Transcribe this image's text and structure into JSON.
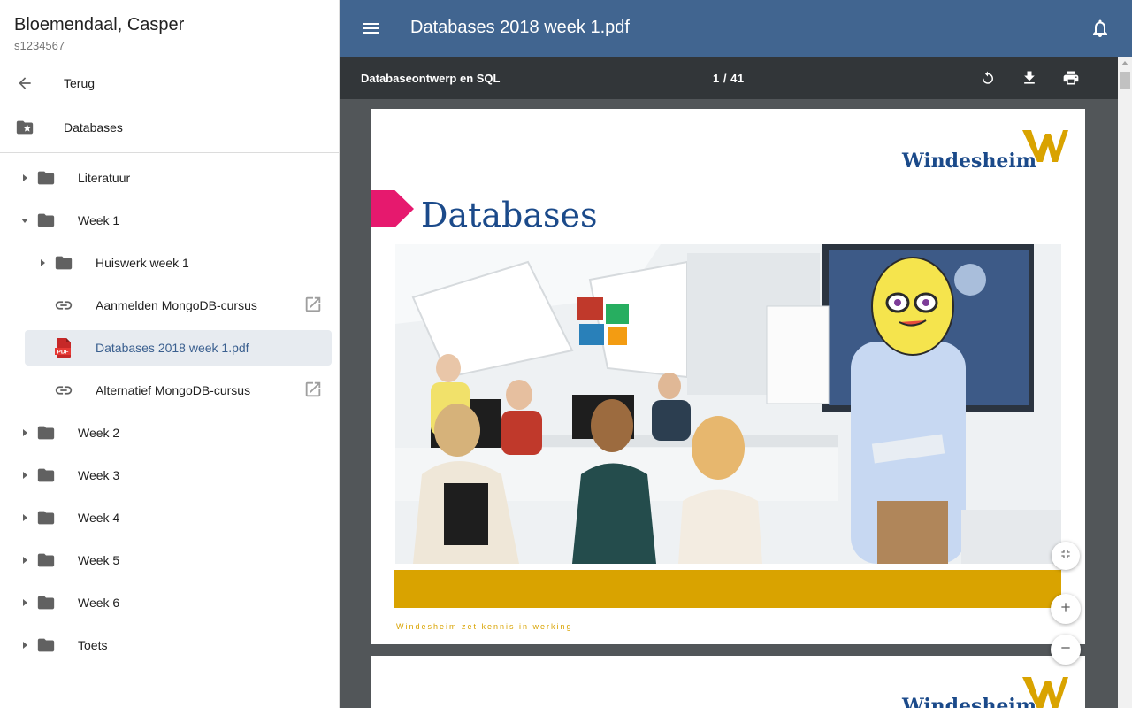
{
  "user": {
    "name": "Bloemendaal, Casper",
    "id": "s1234567"
  },
  "nav": {
    "back_label": "Terug",
    "course_label": "Databases"
  },
  "tree": [
    {
      "label": "Literatuur",
      "type": "folder",
      "expanded": false
    },
    {
      "label": "Week 1",
      "type": "folder",
      "expanded": true
    },
    {
      "label": "Huiswerk week 1",
      "type": "folder",
      "expanded": false
    },
    {
      "label": "Aanmelden MongoDB-cursus",
      "type": "link"
    },
    {
      "label": "Databases 2018 week 1.pdf",
      "type": "pdf",
      "selected": true
    },
    {
      "label": "Alternatief MongoDB-cursus",
      "type": "link"
    },
    {
      "label": "Week 2",
      "type": "folder",
      "expanded": false
    },
    {
      "label": "Week 3",
      "type": "folder",
      "expanded": false
    },
    {
      "label": "Week 4",
      "type": "folder",
      "expanded": false
    },
    {
      "label": "Week 5",
      "type": "folder",
      "expanded": false
    },
    {
      "label": "Week 6",
      "type": "folder",
      "expanded": false
    },
    {
      "label": "Toets",
      "type": "folder",
      "expanded": false
    }
  ],
  "topbar": {
    "title": "Databases 2018 week 1.pdf"
  },
  "viewer": {
    "doc_title": "Databaseontwerp en SQL",
    "current_page": "1",
    "page_separator": "/",
    "total_pages": "41"
  },
  "slide": {
    "brand": "Windesheim",
    "title": "Databases",
    "tagline": "Windesheim zet kennis in werking"
  },
  "colors": {
    "topbar": "#416590",
    "viewer_bg": "#525659",
    "toolbar_bg": "#323639",
    "brand_blue": "#1b4a8a",
    "brand_gold": "#d9a300",
    "accent_pink": "#e6196e",
    "selected_bg": "#e7ebf0"
  },
  "icons": {
    "back": "arrow-left-icon",
    "course": "folder-star-icon",
    "folder": "folder-icon",
    "link": "link-icon",
    "pdf": "pdf-file-icon",
    "external": "open-in-new-icon",
    "menu": "menu-icon",
    "bell": "bell-icon",
    "rotate": "rotate-icon",
    "download": "download-icon",
    "print": "print-icon",
    "fit": "fit-page-icon",
    "zoom_in": "zoom-in-icon",
    "zoom_out": "zoom-out-icon"
  }
}
